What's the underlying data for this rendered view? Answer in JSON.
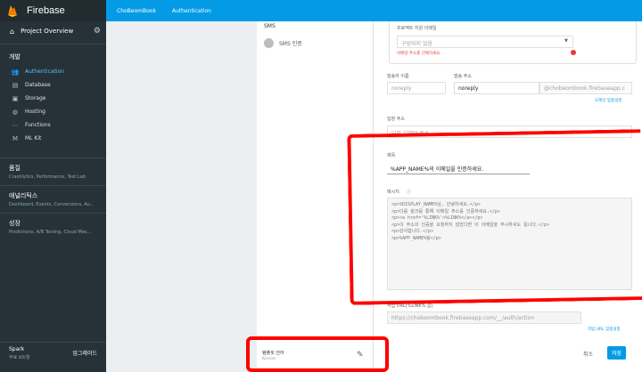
{
  "colors": {
    "sidebar": "#263238",
    "accent": "#039be5",
    "active": "#4fc3f7",
    "annotation": "#ff0000"
  },
  "sidebar": {
    "brand": "Firebase",
    "project_overview": "Project Overview",
    "develop_title": "개발",
    "items": [
      {
        "icon": "people-icon",
        "label": "Authentication",
        "active": true
      },
      {
        "icon": "database-icon",
        "label": "Database"
      },
      {
        "icon": "storage-icon",
        "label": "Storage"
      },
      {
        "icon": "globe-icon",
        "label": "Hosting"
      },
      {
        "icon": "functions-icon",
        "label": "Functions"
      },
      {
        "icon": "mlkit-icon",
        "label": "ML Kit"
      }
    ],
    "groups": [
      {
        "title": "품질",
        "subtitle": "Crashlytics, Performance, Test Lab"
      },
      {
        "title": "애널리틱스",
        "subtitle": "Dashboard, Events, Conversions, Au..."
      },
      {
        "title": "성장",
        "subtitle": "Predictions, A/B Testing, Cloud Mes..."
      }
    ],
    "plan_name": "Spark",
    "plan_price": "무료 $0/월",
    "upgrade": "업그레이드"
  },
  "topbar": {
    "project": "ChoBeomBook",
    "page": "Authentication"
  },
  "sms": {
    "head": "SMS",
    "item": "SMS 인증"
  },
  "form": {
    "support_email_label": "프로젝트 지원 이메일",
    "support_email_placeholder": "구성되지 않음",
    "support_email_error": "이메일 주소를 선택하세요.",
    "sender_name_label": "발송자 이름",
    "sender_name_value": "noreply",
    "from_label": "발송 주소",
    "from_value": "noreply",
    "from_domain": "@chobeombook.firebaseapp.c",
    "custom_domain_link": "도메인 맞춤설정",
    "reply_to_label": "답장 주소",
    "reply_to_placeholder": "답장 이메일 주소",
    "subject_label": "제목",
    "subject_value": "%APP_NAME%의 이메일을 인증하세요.",
    "message_label": "메시지",
    "message_lines": [
      "<p>%DISPLAY_NAME%님, 안녕하세요.</p>",
      "<p>다음 링크를 통해 이메일 주소를 인증하세요.</p>",
      "<p><a href='%LINK%'>%LINK%</a></p>",
      "<p>이 주소의 인증을 요청하지 않았다면 이 이메일을 무시하셔도 됩니다.</p>",
      "<p>감사합니다.</p>",
      "<p>%APP_NAME%팀</p>"
    ],
    "action_url_label": "작업 URL(%LINK% 값)",
    "action_url_value": "https://chobeombook.firebaseapp.com/__/auth/action",
    "action_url_link": "작업 URL 맞춤설정"
  },
  "footer": {
    "item_title": "템플릿 언어",
    "item_sub": "Korean",
    "cancel": "취소",
    "save": "저장"
  }
}
